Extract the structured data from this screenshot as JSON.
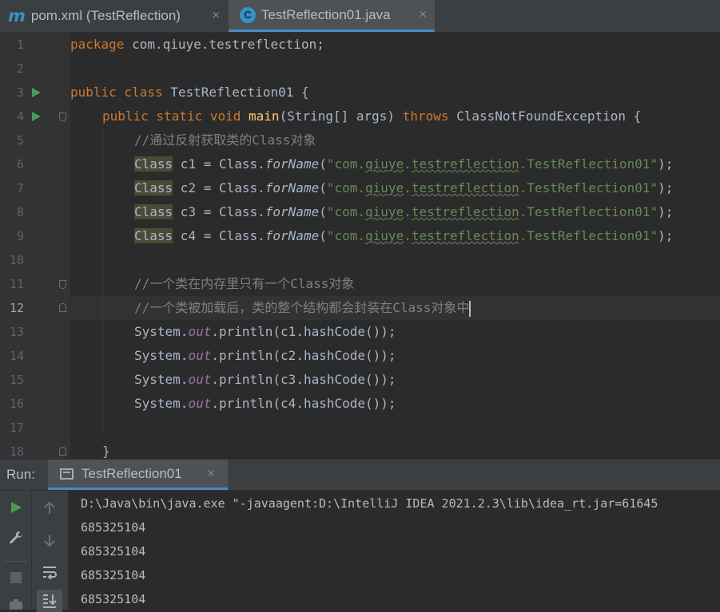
{
  "tabs": [
    {
      "icon": "maven-icon",
      "glyph": "m",
      "label": "pom.xml (TestReflection)",
      "active": false
    },
    {
      "icon": "java-class-icon",
      "glyph": "C",
      "label": "TestReflection01.java",
      "active": true
    }
  ],
  "close_glyph": "×",
  "editor": {
    "line_numbers": [
      "1",
      "2",
      "3",
      "4",
      "5",
      "6",
      "7",
      "8",
      "9",
      "10",
      "11",
      "12",
      "13",
      "14",
      "15",
      "16",
      "17",
      "18"
    ],
    "current_line": "12",
    "code": {
      "l1": {
        "kw": "package",
        "rest": " com.qiuye.testreflection;"
      },
      "l3": {
        "kw": "public class",
        "rest": " TestReflection01 {"
      },
      "l4": {
        "kw1": "public static void",
        "fn": "main",
        "args": "(String[] args) ",
        "kw2": "throws",
        "rest": " ClassNotFoundException {"
      },
      "l5": {
        "comment": "//通过反射获取类的Class对象"
      },
      "class_word": "Class",
      "eq": " = Class.",
      "forname": "forName",
      "open": "(",
      "str_open": "\"com.",
      "str_pkg1": "qiuye",
      "str_dot1": ".",
      "str_pkg2": "testreflection",
      "str_tail": ".TestReflection01\"",
      "close": ");",
      "vars": [
        " c1",
        " c2",
        " c3",
        " c4"
      ],
      "l11": {
        "comment": "//一个类在内存里只有一个Class对象"
      },
      "l12": {
        "comment": "//一个类被加载后，类的整个结构都会封装在Class对象中"
      },
      "sys": "System.",
      "out": "out",
      "println": ".println(",
      "hash_args": [
        "c1",
        "c2",
        "c3",
        "c4"
      ],
      "hash_tail": ".hashCode());",
      "l18": {
        "text": "}"
      }
    }
  },
  "run_panel": {
    "label": "Run:",
    "tab": "TestReflection01",
    "output": [
      "D:\\Java\\bin\\java.exe \"-javaagent:D:\\IntelliJ IDEA 2021.2.3\\lib\\idea_rt.jar=61645",
      "685325104",
      "685325104",
      "685325104",
      "685325104"
    ]
  },
  "colors": {
    "accent": "#4a88c7",
    "keyword": "#cc7832",
    "string": "#6a8759",
    "run_green": "#499c54"
  }
}
